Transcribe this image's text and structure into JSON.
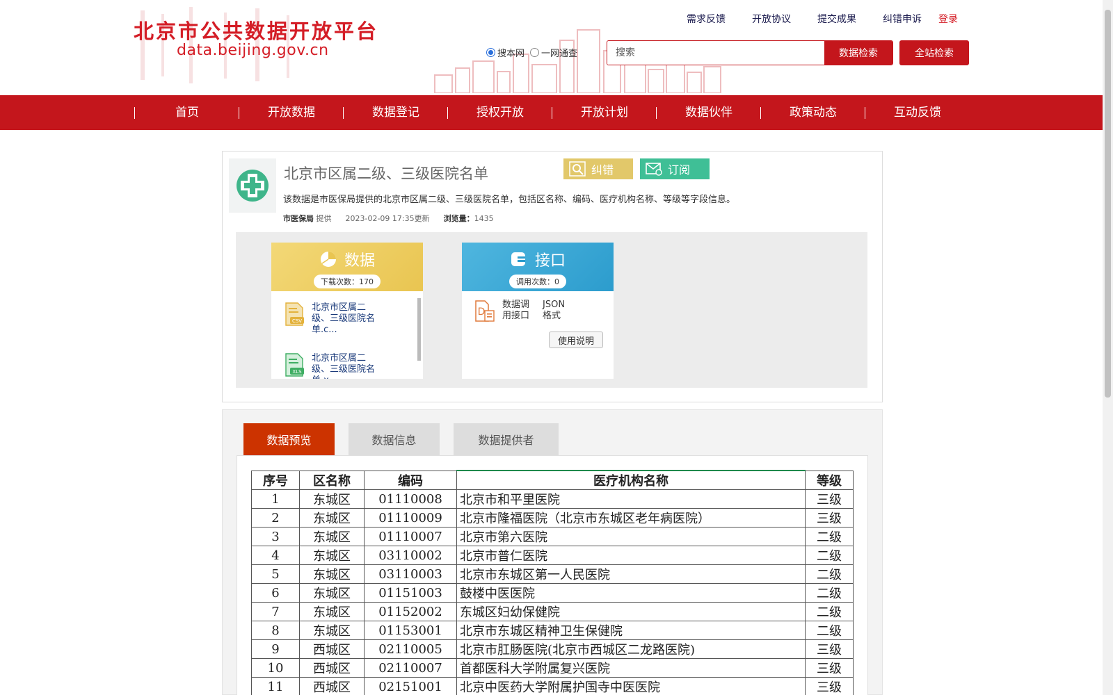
{
  "header": {
    "site_title": "北京市公共数据开放平台",
    "site_url": "data.beijing.gov.cn",
    "top_links": [
      "需求反馈",
      "开放协议",
      "提交成果",
      "纠错申诉"
    ],
    "login": "登录",
    "radio_local": "搜本网",
    "radio_all": "一网通查",
    "search_placeholder": "搜索",
    "search_button": "数据检索",
    "full_search_button": "全站检索"
  },
  "nav": [
    "首页",
    "开放数据",
    "数据登记",
    "授权开放",
    "开放计划",
    "数据伙伴",
    "政策动态",
    "互动反馈"
  ],
  "dataset": {
    "title": "北京市区属二级、三级医院名单",
    "correct_button": "纠错",
    "subscribe_button": "订阅",
    "description": "该数据是市医保局提供的北京市区属二级、三级医院名单，包括区名称、编码、医疗机构名称、等级等字段信息。",
    "provider": "市医保局",
    "provider_suffix": "提供",
    "updated": "2023-02-09 17:35更新",
    "views_label": "浏览量：",
    "views": "1435"
  },
  "data_panel": {
    "title": "数据",
    "downloads": "下载次数：170",
    "files": [
      {
        "name": "北京市区属二级、三级医院名单.c...",
        "type": "CSV"
      },
      {
        "name": "北京市区属二级、三级医院名单.x...",
        "type": "XLS"
      }
    ]
  },
  "api_panel": {
    "title": "接口",
    "calls": "调用次数：0",
    "label": "数据调用接口",
    "format": "JSON格式",
    "usage_button": "使用说明"
  },
  "tabs": [
    "数据预览",
    "数据信息",
    "数据提供者"
  ],
  "table": {
    "headers": [
      "序号",
      "区名称",
      "编码",
      "医疗机构名称",
      "等级"
    ],
    "rows": [
      [
        "1",
        "东城区",
        "01110008",
        "北京市和平里医院",
        "三级"
      ],
      [
        "2",
        "东城区",
        "01110009",
        "北京市隆福医院（北京市东城区老年病医院）",
        "三级"
      ],
      [
        "3",
        "东城区",
        "01110007",
        "北京市第六医院",
        "二级"
      ],
      [
        "4",
        "东城区",
        "03110002",
        "北京市普仁医院",
        "二级"
      ],
      [
        "5",
        "东城区",
        "03110003",
        "北京市东城区第一人民医院",
        "二级"
      ],
      [
        "6",
        "东城区",
        "01151003",
        "鼓楼中医医院",
        "二级"
      ],
      [
        "7",
        "东城区",
        "01152002",
        "东城区妇幼保健院",
        "二级"
      ],
      [
        "8",
        "东城区",
        "01153001",
        "北京市东城区精神卫生保健院",
        "二级"
      ],
      [
        "9",
        "西城区",
        "02110005",
        "北京市肛肠医院(北京市西城区二龙路医院)",
        "三级"
      ],
      [
        "10",
        "西城区",
        "02110007",
        "首都医科大学附属复兴医院",
        "三级"
      ],
      [
        "11",
        "西城区",
        "02151001",
        "北京中医药大学附属护国寺中医医院",
        "三级"
      ]
    ]
  },
  "colors": {
    "brand_red": "#c4161c",
    "tab_active": "#cc3300",
    "correct_yellow": "#e2c86a",
    "subscribe_green": "#3fbf96"
  },
  "icons": [
    "search-icon",
    "mail-icon",
    "pie-chart-icon",
    "api-icon",
    "csv-file-icon",
    "xls-file-icon",
    "doc-icon",
    "hospital-cross-icon"
  ]
}
